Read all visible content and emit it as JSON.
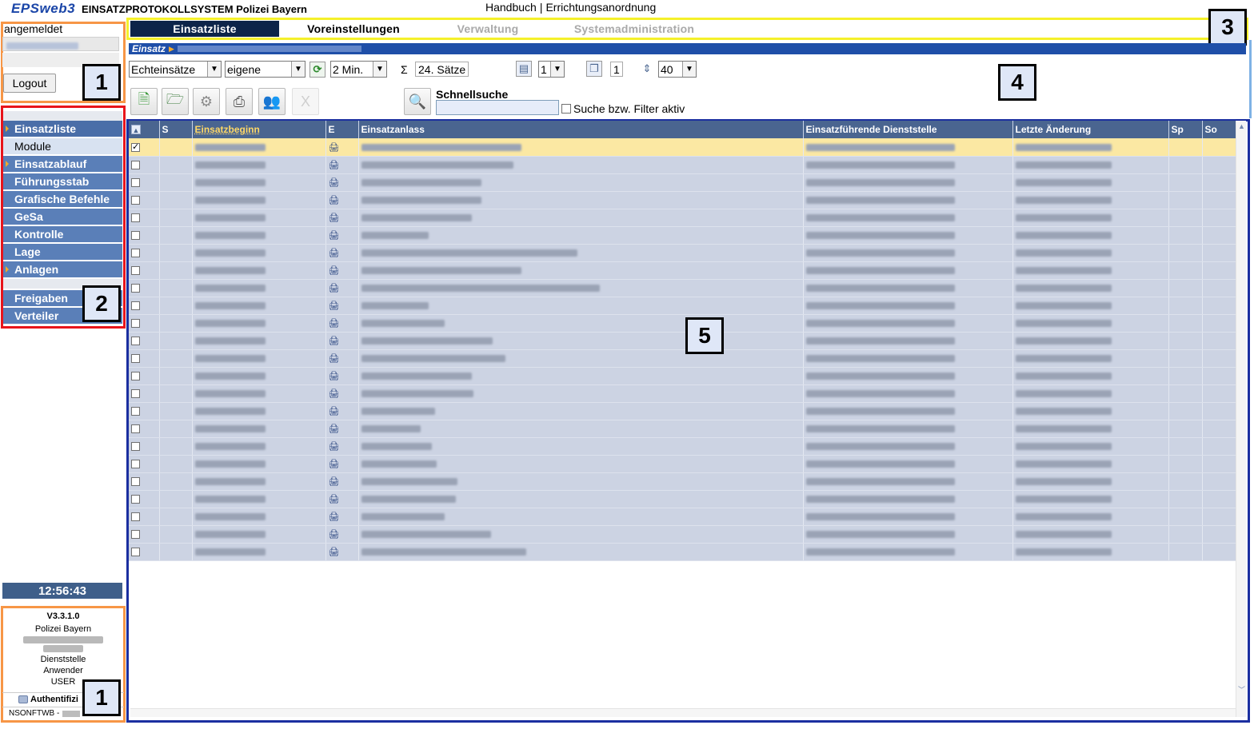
{
  "header": {
    "logo": "EPSweb3",
    "app_name": "EINSATZPROTOKOLLSYSTEM Polizei Bayern",
    "link_handbuch": "Handbuch",
    "link_separator": "|",
    "link_errichtung": "Errichtungsanordnung"
  },
  "login": {
    "status": "angemeldet",
    "logout_label": "Logout"
  },
  "nav": {
    "items": [
      {
        "label": "Einsatzliste"
      },
      {
        "label": "Module"
      },
      {
        "label": "Einsatzablauf"
      },
      {
        "label": "Führungsstab"
      },
      {
        "label": "Grafische Befehle"
      },
      {
        "label": "GeSa"
      },
      {
        "label": "Kontrolle"
      },
      {
        "label": "Lage"
      },
      {
        "label": "Anlagen"
      },
      {
        "label": "Freigaben"
      },
      {
        "label": "Verteiler"
      }
    ]
  },
  "clock": "12:56:43",
  "info": {
    "version": "V3.3.1.0",
    "org": "Polizei Bayern",
    "dienststelle": "Dienststelle",
    "anwender": "Anwender",
    "role": "USER",
    "auth": "Authentifizi",
    "env": "NSONFTWB -"
  },
  "tabs": [
    {
      "label": "Einsatzliste",
      "state": "active"
    },
    {
      "label": "Voreinstellungen",
      "state": "normal"
    },
    {
      "label": "Verwaltung",
      "state": "disabled"
    },
    {
      "label": "Systemadministration",
      "state": "disabled"
    }
  ],
  "breadcrumb": {
    "label": "Einsatz"
  },
  "toolbar": {
    "type_select": "Echteinsätze",
    "owner_select": "eigene",
    "refresh_select": "2 Min.",
    "sum_symbol": "Σ",
    "record_count": "24. Sätze",
    "page_select": "1",
    "pages_value": "1",
    "rows_select": "40",
    "quicksearch_label": "Schnellsuche",
    "quicksearch_value": "",
    "filter_label": "Suche bzw. Filter aktiv",
    "disabled_button_label": "X"
  },
  "table": {
    "columns": [
      "",
      "S",
      "Einsatzbeginn",
      "E",
      "Einsatzanlass",
      "Einsatzführende Dienststelle",
      "Letzte Änderung",
      "Sp",
      "So"
    ],
    "sorted_column": "Einsatzbeginn",
    "rows": [
      {
        "checked": true,
        "s": "",
        "begin": "",
        "e": "",
        "anlass": "",
        "dienststelle": "",
        "aenderung": "",
        "sp": "",
        "so": ""
      },
      {
        "checked": false,
        "s": "",
        "begin": "",
        "e": "",
        "anlass": "",
        "dienststelle": "",
        "aenderung": "",
        "sp": "",
        "so": ""
      },
      {
        "checked": false,
        "s": "",
        "begin": "",
        "e": "",
        "anlass": "",
        "dienststelle": "",
        "aenderung": "",
        "sp": "",
        "so": ""
      },
      {
        "checked": false,
        "s": "",
        "begin": "",
        "e": "",
        "anlass": "",
        "dienststelle": "",
        "aenderung": "",
        "sp": "",
        "so": ""
      },
      {
        "checked": false,
        "s": "",
        "begin": "",
        "e": "",
        "anlass": "",
        "dienststelle": "",
        "aenderung": "",
        "sp": "",
        "so": ""
      },
      {
        "checked": false,
        "s": "",
        "begin": "",
        "e": "",
        "anlass": "",
        "dienststelle": "",
        "aenderung": "",
        "sp": "",
        "so": ""
      },
      {
        "checked": false,
        "s": "",
        "begin": "",
        "e": "",
        "anlass": "",
        "dienststelle": "",
        "aenderung": "",
        "sp": "",
        "so": ""
      },
      {
        "checked": false,
        "s": "",
        "begin": "",
        "e": "",
        "anlass": "",
        "dienststelle": "",
        "aenderung": "",
        "sp": "",
        "so": ""
      },
      {
        "checked": false,
        "s": "",
        "begin": "",
        "e": "",
        "anlass": "",
        "dienststelle": "",
        "aenderung": "",
        "sp": "",
        "so": ""
      },
      {
        "checked": false,
        "s": "",
        "begin": "",
        "e": "",
        "anlass": "",
        "dienststelle": "",
        "aenderung": "",
        "sp": "",
        "so": ""
      },
      {
        "checked": false,
        "s": "",
        "begin": "",
        "e": "",
        "anlass": "",
        "dienststelle": "",
        "aenderung": "",
        "sp": "",
        "so": ""
      },
      {
        "checked": false,
        "s": "",
        "begin": "",
        "e": "",
        "anlass": "",
        "dienststelle": "",
        "aenderung": "",
        "sp": "",
        "so": ""
      },
      {
        "checked": false,
        "s": "",
        "begin": "",
        "e": "",
        "anlass": "",
        "dienststelle": "",
        "aenderung": "",
        "sp": "",
        "so": ""
      },
      {
        "checked": false,
        "s": "",
        "begin": "",
        "e": "",
        "anlass": "",
        "dienststelle": "",
        "aenderung": "",
        "sp": "",
        "so": ""
      },
      {
        "checked": false,
        "s": "",
        "begin": "",
        "e": "",
        "anlass": "",
        "dienststelle": "",
        "aenderung": "",
        "sp": "",
        "so": ""
      },
      {
        "checked": false,
        "s": "",
        "begin": "",
        "e": "",
        "anlass": "",
        "dienststelle": "",
        "aenderung": "",
        "sp": "",
        "so": ""
      },
      {
        "checked": false,
        "s": "",
        "begin": "",
        "e": "",
        "anlass": "",
        "dienststelle": "",
        "aenderung": "",
        "sp": "",
        "so": ""
      },
      {
        "checked": false,
        "s": "",
        "begin": "",
        "e": "",
        "anlass": "",
        "dienststelle": "",
        "aenderung": "",
        "sp": "",
        "so": ""
      },
      {
        "checked": false,
        "s": "",
        "begin": "",
        "e": "",
        "anlass": "",
        "dienststelle": "",
        "aenderung": "",
        "sp": "",
        "so": ""
      },
      {
        "checked": false,
        "s": "",
        "begin": "",
        "e": "",
        "anlass": "",
        "dienststelle": "",
        "aenderung": "",
        "sp": "",
        "so": ""
      },
      {
        "checked": false,
        "s": "",
        "begin": "",
        "e": "",
        "anlass": "",
        "dienststelle": "",
        "aenderung": "",
        "sp": "",
        "so": ""
      },
      {
        "checked": false,
        "s": "",
        "begin": "",
        "e": "",
        "anlass": "",
        "dienststelle": "",
        "aenderung": "",
        "sp": "",
        "so": ""
      },
      {
        "checked": false,
        "s": "",
        "begin": "",
        "e": "",
        "anlass": "",
        "dienststelle": "",
        "aenderung": "",
        "sp": "",
        "so": ""
      },
      {
        "checked": false,
        "s": "",
        "begin": "",
        "e": "",
        "anlass": "",
        "dienststelle": "",
        "aenderung": "",
        "sp": "",
        "so": ""
      }
    ]
  },
  "markers": {
    "m1_top": "1",
    "m2": "2",
    "m3": "3",
    "m4": "4",
    "m5": "5",
    "m1_bottom": "1"
  },
  "colors": {
    "frame_orange": "#f79646",
    "frame_red": "#e8141b",
    "frame_yellow": "#f5f02a",
    "frame_blue": "#1b2fa0",
    "frame_lightblue": "#7fb2e5",
    "tab_active_bg": "#0d2449",
    "header_bg": "#4a6590",
    "row_bg": "#ccd3e3",
    "row_selected_bg": "#fbe8a3",
    "nav_bg": "#5a7fb8"
  }
}
